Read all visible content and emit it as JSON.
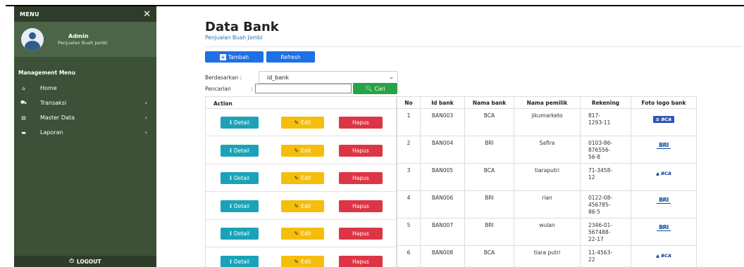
{
  "sidebar": {
    "header": "MENU",
    "close_glyph": "✕",
    "user_name": "Admin",
    "user_role": "Penjualan Buah Jambi",
    "section": "Management Menu",
    "items": [
      {
        "label": "Home",
        "icon": "home-icon",
        "glyph": "⌂",
        "chevron": ""
      },
      {
        "label": "Transaksi",
        "icon": "cart-icon",
        "glyph": "⛟",
        "chevron": "›"
      },
      {
        "label": "Master Data",
        "icon": "data-icon",
        "glyph": "▤",
        "chevron": "›"
      },
      {
        "label": "Laporan",
        "icon": "report-icon",
        "glyph": "▬",
        "chevron": "›"
      }
    ],
    "logout": "LOGOUT"
  },
  "page": {
    "title": "Data Bank",
    "subtitle": "Penjualan Buah Jambi"
  },
  "toolbar": {
    "tambah": "Tambah",
    "refresh": "Refresh"
  },
  "filter": {
    "by_label": "Berdasarkan :",
    "by_value": "id_bank",
    "search_label": "Pencarian",
    "search_colon": ":",
    "search_value": "",
    "cari": "Cari"
  },
  "actions": {
    "header": "Action",
    "detail": "Detail",
    "edit": "Edit",
    "hapus": "Hapus"
  },
  "table": {
    "headers": [
      "No",
      "Id bank",
      "Nama bank",
      "Nama pemilik",
      "Rekening",
      "Foto logo bank"
    ],
    "rows": [
      {
        "no": "1",
        "id": "BAN003",
        "bank": "BCA",
        "owner": "jikumarketo",
        "rek": "817-\n1293-11",
        "logo": "bca-badge",
        "logo_text": "BCA"
      },
      {
        "no": "2",
        "id": "BAN004",
        "bank": "BRI",
        "owner": "Safira",
        "rek": "0103-86-\n876556-\n56-8",
        "logo": "bri",
        "logo_text": "BRI"
      },
      {
        "no": "3",
        "id": "BAN005",
        "bank": "BCA",
        "owner": "tiaraputri",
        "rek": "71-3458-\n12",
        "logo": "bca",
        "logo_text": "BCA"
      },
      {
        "no": "4",
        "id": "BAN006",
        "bank": "BRI",
        "owner": "rian",
        "rek": "0122-08-\n456785-\n86-5",
        "logo": "bri",
        "logo_text": "BRI"
      },
      {
        "no": "5",
        "id": "BAN007",
        "bank": "BRI",
        "owner": "wulan",
        "rek": "2346-01-\n567488-\n22-17",
        "logo": "bri",
        "logo_text": "BRI"
      },
      {
        "no": "6",
        "id": "BAN008",
        "bank": "BCA",
        "owner": "tiara putri",
        "rek": "11-4563-\n22",
        "logo": "bca",
        "logo_text": "BCA"
      }
    ]
  },
  "colors": {
    "sidebar": "#3c5138",
    "primary": "#1f6fe6",
    "success": "#27a347",
    "info": "#1aa3b8",
    "warning": "#f5bd0c",
    "danger": "#dc3545"
  }
}
